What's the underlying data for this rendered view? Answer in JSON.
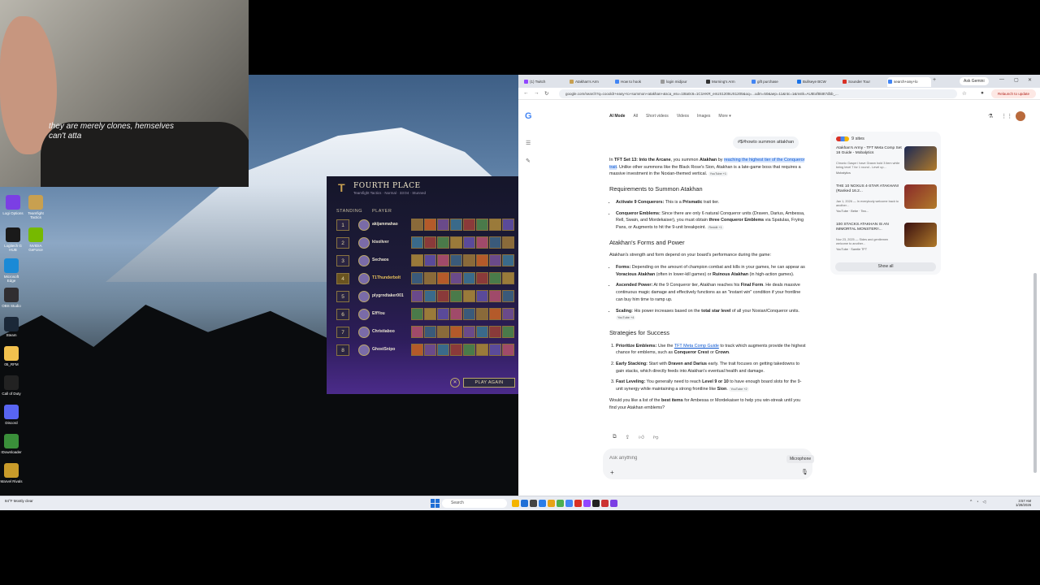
{
  "webcam": {
    "caption": "they are merely clones, hemselves can't atta"
  },
  "desktop_icons": [
    {
      "label": "Logi Options",
      "color": "#7b3fe4"
    },
    {
      "label": "Teamfight Tactics",
      "color": "#c8a050"
    },
    {
      "label": "Logitech G HUB",
      "color": "#1a1a1a"
    },
    {
      "label": "NVIDIA GeForce",
      "color": "#76b900"
    },
    {
      "label": "Microsoft Edge",
      "color": "#1b8ad6"
    },
    {
      "label": "OBS Studio",
      "color": "#302e31"
    },
    {
      "label": "Steam",
      "color": "#1b2838"
    },
    {
      "label": "05_RFM",
      "color": "#f2c14e"
    },
    {
      "label": "Call of Duty",
      "color": "#222"
    },
    {
      "label": "Discord",
      "color": "#5865f2"
    },
    {
      "label": "IDownloader",
      "color": "#3a8f3a"
    },
    {
      "label": "Marvel Rivals",
      "color": "#c89b2a"
    }
  ],
  "tft": {
    "title": "FOURTH PLACE",
    "subtitle": "Teamfight Tactics · Normal · 33:04 · Stunned",
    "col_standing": "STANDING",
    "col_player": "PLAYER",
    "rows": [
      {
        "rank": "1",
        "name": "akijammahao",
        "me": false
      },
      {
        "rank": "2",
        "name": "ktsoliver",
        "me": false
      },
      {
        "rank": "3",
        "name": "Sechaos",
        "me": false
      },
      {
        "rank": "4",
        "name": "T1Thunderbolt",
        "me": true
      },
      {
        "rank": "5",
        "name": "plygrndtaker001",
        "me": false
      },
      {
        "rank": "6",
        "name": "EffYou",
        "me": false
      },
      {
        "rank": "7",
        "name": "Christiaboo",
        "me": false
      },
      {
        "rank": "8",
        "name": "GhostSnipo",
        "me": false
      }
    ],
    "play_again": "PLAY AGAIN",
    "close": "✕",
    "unit_colors": [
      "#8a6a3a",
      "#b45a2a",
      "#6a4a8a",
      "#3a6a8a",
      "#8a3a3a",
      "#4a7a4a",
      "#9a7a3a",
      "#5a4a9a",
      "#a04a6a",
      "#3a5a7a"
    ]
  },
  "browser": {
    "tabs": [
      {
        "label": "(1) Twitch",
        "color": "#9146ff"
      },
      {
        "label": "Atakhan's Arm",
        "color": "#c8a050"
      },
      {
        "label": "How to hook",
        "color": "#4285f4"
      },
      {
        "label": "login midjour",
        "color": "#999"
      },
      {
        "label": "Morning's Arm",
        "color": "#333"
      },
      {
        "label": "gift purchase",
        "color": "#4285f4"
      },
      {
        "label": "Bullseye BCW",
        "color": "#1a73e8"
      },
      {
        "label": "Sounder Tour",
        "color": "#d93025"
      },
      {
        "label": "search+any+lo",
        "color": "#4285f4",
        "active": true
      }
    ],
    "new_tab": "+",
    "ask_gemini": "Ask Gemini",
    "url": "google.com/search?q=coooldr+easy+to+summon+atakhan+&sca_esv=1t8a0c6=1C1HKR_enUS1205US1205&oq=...udm=50&aep=11&ntc=1&mstk=AUtExfBk8t7dbb_...",
    "relaunch": "Relaunch to update",
    "modes": [
      "AI Mode",
      "All",
      "Short videos",
      "Videos",
      "Images",
      "More ▾"
    ],
    "query": "#$#howto summon attakhan",
    "answer": {
      "intro_1": "In ",
      "intro_b1": "TFT Set 13: Into the Arcane",
      "intro_2": ", you summon ",
      "intro_b2": "Atakhan",
      "intro_3": " by ",
      "intro_hl": "reaching the highest tier of the Conqueror trait",
      "intro_4": ". Unlike other summons like the Black Rose's Sion, Atakhan is a late-game boss that requires a massive investment in the Noxian-themed vertical.",
      "intro_chip": "YouTube +1",
      "h_req": "Requirements to Summon Atakhan",
      "req1_b": "Activate 9 Conquerors:",
      "req1_t": " This is a ",
      "req1_b2": "Prismatic",
      "req1_t2": " trait tier.",
      "req2_b": "Conqueror Emblems:",
      "req2_t": " Since there are only 6 natural Conqueror units (Draven, Darius, Ambessa, Rell, Swain, and Mordekaiser), you must obtain ",
      "req2_b2": "three Conqueror Emblems",
      "req2_t2": " via Spatulas, Frying Pans, or Augments to hit the 9-unit breakpoint.",
      "req2_chip": "Reddit +1",
      "h_forms": "Atakhan's Forms and Power",
      "forms_intro": "Atakhan's strength and form depend on your board's performance during the game:",
      "f1_b": "Forms:",
      "f1_t": " Depending on the amount of champion combat and kills in your games, he can appear as ",
      "f1_b2": "Voracious Atakhan",
      "f1_t2": " (often in lower-kill games) or ",
      "f1_b3": "Ruinous Atakhan",
      "f1_t3": " (in high-action games).",
      "f2_b": "Ascended Power:",
      "f2_t": " At the 9 Conqueror tier, Atakhan reaches his ",
      "f2_b2": "Final Form",
      "f2_t2": ". He deals massive continuous magic damage and effectively functions as an \"instant win\" condition if your frontline can buy him time to ramp up.",
      "f3_b": "Scaling:",
      "f3_t": " His power increases based on the ",
      "f3_b2": "total star level",
      "f3_t2": " of all your Noxian/Conqueror units.",
      "f3_chip": "YouTube +4",
      "h_strat": "Strategies for Success",
      "s1_b": "Prioritize Emblems:",
      "s1_t": " Use the ",
      "s1_link": "TFT Meta Comp Guide",
      "s1_t2": " to track which augments provide the highest chance for emblems, such as ",
      "s1_b2": "Conqueror Crest",
      "s1_t3": " or ",
      "s1_b3": "Crown",
      "s1_t4": ".",
      "s2_b": "Early Stacking:",
      "s2_t": " Start with ",
      "s2_b2": "Draven and Darius",
      "s2_t2": " early. The trait focuses on getting takedowns to gain stacks, which directly feeds into Atakhan's eventual health and damage.",
      "s3_b": "Fast Leveling:",
      "s3_t": " You generally need to reach ",
      "s3_b2": "Level 9 or 10",
      "s3_t2": " to have enough board slots for the 9-unit synergy while maintaining a strong frontline like ",
      "s3_b3": "Sion",
      "s3_t3": ".",
      "s3_chip": "YouTube +2",
      "closing_1": "Would you like a list of the ",
      "closing_b": "best items",
      "closing_2": " for Ambessa or Mordekaiser to help you win-streak until you find your Atakhan emblems?"
    },
    "ask_placeholder": "Ask anything",
    "mic_tip": "Microphone",
    "sources": {
      "count_label": "9 sites",
      "items": [
        {
          "title": "Atakhan's Army - TFT Meta Comp Set 16 Guide - Mobalytics",
          "desc": "Chronic Gaspe i have Grasm hold 3 item while being level 7 for 1 round - Level up...",
          "meta": "Mobalytics",
          "thumb": "#1d2a55"
        },
        {
          "title": "THE 10 NOXUS 4-STAR ATAKHAN! (Ranked 16.2...",
          "desc": "Jan 1, 2026 — In everybody welcome back to another...",
          "meta": "YouTube · Bebe · Tea...",
          "thumb": "#8a2a2a"
        },
        {
          "title": "100 STACKS ATAKHAN IS AN IMMORTAL MONSTER!!...",
          "desc": "Nov 23, 2025 — Sides and gentlemen welcome to another...",
          "meta": "YouTube · Samtie TFT",
          "thumb": "#3a1010"
        }
      ],
      "show_all": "Show all"
    }
  },
  "taskbar": {
    "weather": "84°F Mostly clear",
    "search": "Search",
    "time": "3:57 AM",
    "date": "1/28/2026",
    "apps": [
      "#f4b400",
      "#1f6fd6",
      "#444",
      "#2b7de9",
      "#e8a317",
      "#4caf50",
      "#4285f4",
      "#d93025",
      "#9146ff",
      "#222",
      "#c33",
      "#7b3fe4"
    ]
  }
}
